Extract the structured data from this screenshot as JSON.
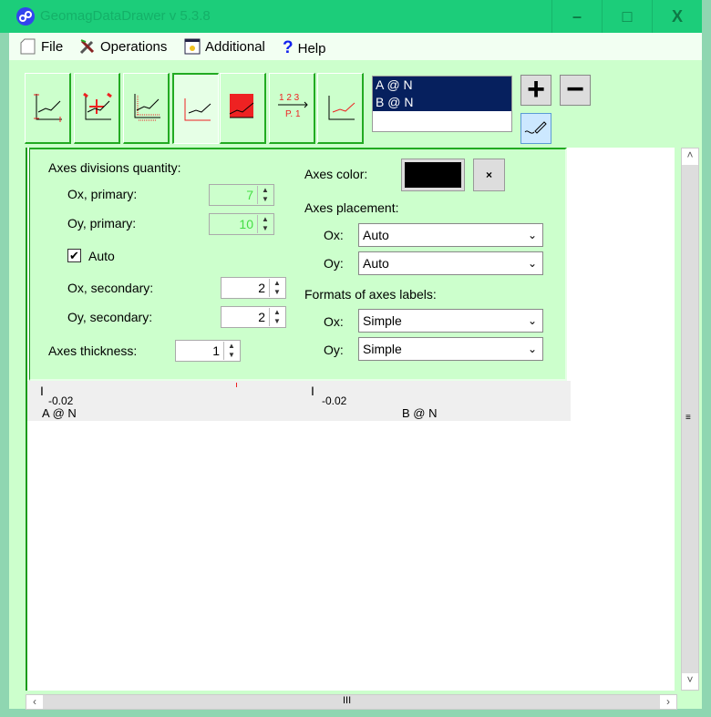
{
  "window": {
    "title": "GeomagDataDrawer v 5.3.8",
    "minimize": "–",
    "maximize": "□",
    "close": "X"
  },
  "menu": [
    {
      "label": "File",
      "icon": "file-icon"
    },
    {
      "label": "Operations",
      "icon": "tools-icon"
    },
    {
      "label": "Additional",
      "icon": "window-icon"
    },
    {
      "label": "Help",
      "icon": "help-icon"
    }
  ],
  "toolbar": {
    "buttons": [
      "axes-scale",
      "move-zoom",
      "grid-lines",
      "axes-settings",
      "fill-area",
      "labels-numbering",
      "line-style"
    ],
    "selected": "axes-settings",
    "p_label": "P. 1",
    "nums_label": "1 2 3"
  },
  "series": {
    "items": [
      "A @ N",
      "B @ N"
    ],
    "add": "+",
    "remove": "−"
  },
  "panel": {
    "divisions_title": "Axes divisions quantity:",
    "ox_primary_label": "Ox, primary:",
    "ox_primary_value": "7",
    "oy_primary_label": "Oy, primary:",
    "oy_primary_value": "10",
    "auto_label": "Auto",
    "auto_checked": true,
    "ox_secondary_label": "Ox, secondary:",
    "ox_secondary_value": "2",
    "oy_secondary_label": "Oy, secondary:",
    "oy_secondary_value": "2",
    "thickness_label": "Axes thickness:",
    "thickness_value": "1",
    "color_label": "Axes color:",
    "axes_color": "#000000",
    "clear_color": "×",
    "placement_title": "Axes placement:",
    "place_ox_label": "Ox:",
    "place_ox_value": "Auto",
    "place_oy_label": "Oy:",
    "place_oy_value": "Auto",
    "formats_title": "Formats of axes labels:",
    "fmt_ox_label": "Ox:",
    "fmt_ox_value": "Simple",
    "fmt_oy_label": "Oy:",
    "fmt_oy_value": "Simple"
  },
  "plot": {
    "a_tick": "-0.02",
    "a_name": "A @ N",
    "b_tick": "-0.02",
    "b_name": "B @ N"
  }
}
